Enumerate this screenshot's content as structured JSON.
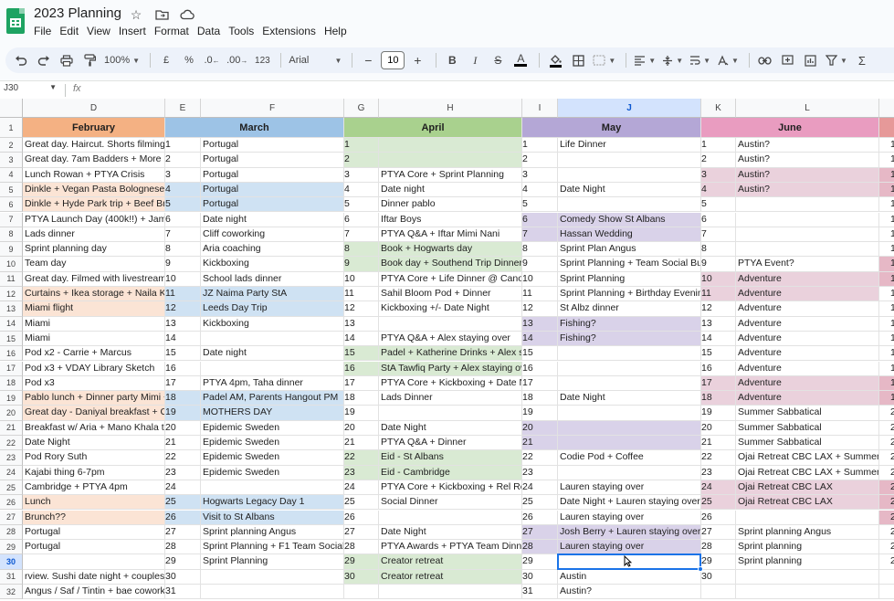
{
  "app": {
    "title": "2023 Planning",
    "icons": [
      "star-icon",
      "move-to-folder-icon",
      "cloud-status-icon"
    ]
  },
  "menu": [
    "File",
    "Edit",
    "View",
    "Insert",
    "Format",
    "Data",
    "Tools",
    "Extensions",
    "Help"
  ],
  "toolbar": {
    "zoom": "100%",
    "currency": "£",
    "percent": "%",
    "dec_decrease": ".0",
    "dec_increase": ".00",
    "number_format": "123",
    "font": "Arial",
    "font_size": "10",
    "minus": "−",
    "plus": "+",
    "bold": "B",
    "italic": "I",
    "strike": "S",
    "text_color": "A",
    "sigma": "Σ"
  },
  "formula_bar": {
    "name_box": "J30",
    "fx": "fx"
  },
  "columns": [
    {
      "letter": "D"
    },
    {
      "letter": "E"
    },
    {
      "letter": "F"
    },
    {
      "letter": "G"
    },
    {
      "letter": "H"
    },
    {
      "letter": "I"
    },
    {
      "letter": "J"
    },
    {
      "letter": "K"
    },
    {
      "letter": "L"
    },
    {
      "letter": ""
    }
  ],
  "active_cell": {
    "col": "J",
    "row": 30
  },
  "months": [
    {
      "name": "February",
      "color": "#f4b183"
    },
    {
      "name": "March",
      "color": "#9dc3e6"
    },
    {
      "name": "April",
      "color": "#a9d18e"
    },
    {
      "name": "May",
      "color": "#b4a7d6"
    },
    {
      "name": "June",
      "color": "#e99cc0"
    }
  ],
  "colors": {
    "feb_shade": "#fbe4d5",
    "mar_shade": "#cfe2f3",
    "apr_shade": "#d9ead3",
    "may_shade": "#d9d2e9",
    "jun_shade": "#ead1dc",
    "accent": "#1a73e8"
  },
  "rows": [
    {
      "n": 1
    },
    {
      "n": 2,
      "feb": "Great day. Haircut. Shorts filming.",
      "mar_d": "1",
      "mar": "Portugal",
      "apr_d": "1",
      "apr": "",
      "may_d": "1",
      "may": "Life Dinner",
      "jun_d": "1",
      "jun": "Austin?",
      "aprS": true
    },
    {
      "n": 3,
      "feb": "Great day. 7am Badders + More P",
      "mar_d": "2",
      "mar": "Portugal",
      "apr_d": "2",
      "apr": "",
      "may_d": "2",
      "may": "",
      "jun_d": "2",
      "jun": "Austin?",
      "aprS": true
    },
    {
      "n": 4,
      "feb": "Lunch Rowan + PTYA Crisis",
      "mar_d": "3",
      "mar": "Portugal",
      "apr_d": "3",
      "apr": "PTYA Core + Sprint Planning",
      "may_d": "3",
      "may": "",
      "jun_d": "3",
      "jun": "Austin?",
      "junS": true
    },
    {
      "n": 5,
      "feb": "Dinkle + Vegan Pasta Bolognese g",
      "mar_d": "4",
      "mar": "Portugal",
      "apr_d": "4",
      "apr": "Date night",
      "may_d": "4",
      "may": "Date Night",
      "jun_d": "4",
      "jun": "Austin?",
      "febS": true,
      "marS": true,
      "junS": true
    },
    {
      "n": 6,
      "feb": "Dinkle + Hyde Park trip + Beef Bro",
      "mar_d": "5",
      "mar": "Portugal",
      "apr_d": "5",
      "apr": "Dinner pablo",
      "may_d": "5",
      "may": "",
      "jun_d": "5",
      "jun": "",
      "febS": true,
      "marS": true
    },
    {
      "n": 7,
      "feb": "PTYA Launch Day (400k!!) + Jame",
      "mar_d": "6",
      "mar": "Date night",
      "apr_d": "6",
      "apr": "Iftar Boys",
      "may_d": "6",
      "may": "Comedy Show St Albans",
      "jun_d": "6",
      "jun": "",
      "mayS": true
    },
    {
      "n": 8,
      "feb": "Lads dinner",
      "mar_d": "7",
      "mar": "Cliff coworking",
      "apr_d": "7",
      "apr": "PTYA Q&A + Iftar Mimi Nani",
      "may_d": "7",
      "may": "Hassan Wedding",
      "jun_d": "7",
      "jun": "",
      "mayS": true
    },
    {
      "n": 9,
      "feb": "Sprint planning day",
      "mar_d": "8",
      "mar": "Aria coaching",
      "apr_d": "8",
      "apr": "Book + Hogwarts day",
      "may_d": "8",
      "may": "Sprint Plan Angus",
      "jun_d": "8",
      "jun": "",
      "aprS": true
    },
    {
      "n": 10,
      "feb": "Team day",
      "mar_d": "9",
      "mar": "Kickboxing",
      "apr_d": "9",
      "apr": "Book day + Southend Trip Dinner",
      "may_d": "9",
      "may": "Sprint Planning + Team Social Bur",
      "jun_d": "9",
      "jun": "PTYA Event?",
      "aprS": true
    },
    {
      "n": 11,
      "feb": "Great day. Filmed with livestream i",
      "mar_d": "10",
      "mar": "School lads dinner",
      "apr_d": "10",
      "apr": "PTYA Core + Life Dinner @ Canor",
      "may_d": "10",
      "may": "Sprint Planning",
      "jun_d": "10",
      "jun": "Adventure",
      "junS": true
    },
    {
      "n": 12,
      "feb": "Curtains + Ikea storage + Naila Kh",
      "mar_d": "11",
      "mar": "JZ Naima Party StA",
      "apr_d": "11",
      "apr": "Sahil Bloom Pod + Dinner",
      "may_d": "11",
      "may": "Sprint Planning + Birthday Evening",
      "jun_d": "11",
      "jun": "Adventure",
      "febS": true,
      "marS": true,
      "junS": true
    },
    {
      "n": 13,
      "feb": "Miami flight",
      "mar_d": "12",
      "mar": "Leeds Day Trip",
      "apr_d": "12",
      "apr": "Kickboxing +/- Date Night",
      "may_d": "12",
      "may": "St Albz dinner",
      "jun_d": "12",
      "jun": "Adventure",
      "febS": true,
      "marS": true
    },
    {
      "n": 14,
      "feb": "Miami",
      "mar_d": "13",
      "mar": "Kickboxing",
      "apr_d": "13",
      "apr": "",
      "may_d": "13",
      "may": "Fishing?",
      "jun_d": "13",
      "jun": "Adventure",
      "mayS": true
    },
    {
      "n": 15,
      "feb": "Miami",
      "mar_d": "14",
      "mar": "",
      "apr_d": "14",
      "apr": "PTYA Q&A + Alex staying over",
      "may_d": "14",
      "may": "Fishing?",
      "jun_d": "14",
      "jun": "Adventure",
      "mayS": true
    },
    {
      "n": 16,
      "feb": "Pod x2 - Carrie + Marcus",
      "mar_d": "15",
      "mar": "Date night",
      "apr_d": "15",
      "apr": "Padel + Katherine Drinks + Alex st",
      "may_d": "15",
      "may": "",
      "jun_d": "15",
      "jun": "Adventure",
      "aprS": true
    },
    {
      "n": 17,
      "feb": "Pod x3 + VDAY Library Sketch",
      "mar_d": "16",
      "mar": "",
      "apr_d": "16",
      "apr": "StA Tawfiq Party + Alex staying ov",
      "may_d": "16",
      "may": "",
      "jun_d": "16",
      "jun": "Adventure",
      "aprS": true
    },
    {
      "n": 18,
      "feb": "Pod x3",
      "mar_d": "17",
      "mar": "PTYA 4pm, Taha dinner",
      "apr_d": "17",
      "apr": "PTYA Core + Kickboxing + Date N",
      "may_d": "17",
      "may": "",
      "jun_d": "17",
      "jun": "Adventure",
      "junS": true
    },
    {
      "n": 19,
      "feb": "Pablo lunch + Dinner party Mimi +",
      "mar_d": "18",
      "mar": "Padel AM, Parents Hangout PM",
      "apr_d": "18",
      "apr": "Lads Dinner",
      "may_d": "18",
      "may": "Date Night",
      "jun_d": "18",
      "jun": "Adventure",
      "febS": true,
      "marS": true,
      "junS": true
    },
    {
      "n": 20,
      "feb": "Great day - Daniyal breakfast + Co",
      "mar_d": "19",
      "mar": "MOTHERS DAY",
      "apr_d": "19",
      "apr": "",
      "may_d": "19",
      "may": "",
      "jun_d": "19",
      "jun": "Summer Sabbatical",
      "febS": true,
      "marS": true
    },
    {
      "n": 21,
      "feb": "Breakfast w/ Aria + Mano Khala tra",
      "mar_d": "20",
      "mar": "Epidemic Sweden",
      "apr_d": "20",
      "apr": "Date Night",
      "may_d": "20",
      "may": "",
      "jun_d": "20",
      "jun": "Summer Sabbatical",
      "mayS": true
    },
    {
      "n": 22,
      "feb": "Date Night",
      "mar_d": "21",
      "mar": "Epidemic Sweden",
      "apr_d": "21",
      "apr": "PTYA Q&A + Dinner",
      "may_d": "21",
      "may": "",
      "jun_d": "21",
      "jun": "Summer Sabbatical",
      "mayS": true
    },
    {
      "n": 23,
      "feb": "Pod Rory Suth",
      "mar_d": "22",
      "mar": "Epidemic Sweden",
      "apr_d": "22",
      "apr": "Eid - St Albans",
      "may_d": "22",
      "may": "Codie Pod + Coffee",
      "jun_d": "22",
      "jun": "Ojai Retreat CBC LAX + Summer",
      "aprS": true
    },
    {
      "n": 24,
      "feb": "Kajabi thing 6-7pm",
      "mar_d": "23",
      "mar": "Epidemic Sweden",
      "apr_d": "23",
      "apr": "Eid - Cambridge",
      "may_d": "23",
      "may": "",
      "jun_d": "23",
      "jun": "Ojai Retreat CBC LAX + Summer",
      "aprS": true
    },
    {
      "n": 25,
      "feb": "Cambridge + PTYA 4pm",
      "mar_d": "24",
      "mar": "",
      "apr_d": "24",
      "apr": "PTYA Core + Kickboxing + Rel Re",
      "may_d": "24",
      "may": "Lauren staying over",
      "jun_d": "24",
      "jun": "Ojai Retreat CBC LAX",
      "junS": true
    },
    {
      "n": 26,
      "feb": "Lunch",
      "mar_d": "25",
      "mar": "Hogwarts Legacy Day 1",
      "apr_d": "25",
      "apr": "Social Dinner",
      "may_d": "25",
      "may": "Date Night + Lauren staying over",
      "jun_d": "25",
      "jun": "Ojai Retreat CBC LAX",
      "febS": true,
      "marS": true,
      "junS": true
    },
    {
      "n": 27,
      "feb": "Brunch??",
      "mar_d": "26",
      "mar": "Visit to St Albans",
      "apr_d": "26",
      "apr": "",
      "may_d": "26",
      "may": "Lauren staying over",
      "jun_d": "26",
      "jun": "",
      "febS": true,
      "marS": true
    },
    {
      "n": 28,
      "feb": "Portugal",
      "mar_d": "27",
      "mar": "Sprint planning Angus",
      "apr_d": "27",
      "apr": "Date Night",
      "may_d": "27",
      "may": "Josh Berry + Lauren staying over",
      "jun_d": "27",
      "jun": "Sprint planning Angus",
      "mayS": true
    },
    {
      "n": 29,
      "feb": "Portugal",
      "mar_d": "28",
      "mar": "Sprint Planning + F1 Team Social",
      "apr_d": "28",
      "apr": "PTYA Awards + PTYA Team Dinne",
      "may_d": "28",
      "may": "Lauren staying over",
      "jun_d": "28",
      "jun": "Sprint planning",
      "mayS": true
    },
    {
      "n": 30,
      "feb": "",
      "mar_d": "29",
      "mar": "Sprint Planning",
      "apr_d": "29",
      "apr": "Creator retreat",
      "may_d": "29",
      "may": "",
      "jun_d": "29",
      "jun": "Sprint planning",
      "aprS": true
    },
    {
      "n": 31,
      "feb": "rview. Sushi date night + couples th",
      "mar_d": "30",
      "mar": "",
      "apr_d": "30",
      "apr": "Creator retreat",
      "may_d": "30",
      "may": "Austin",
      "jun_d": "30",
      "jun": "",
      "aprS": true
    },
    {
      "n": 32,
      "feb": " Angus / Saf / Tintin + bae coworkin",
      "mar_d": "31",
      "mar": "",
      "apr_d": "",
      "apr": "",
      "may_d": "31",
      "may": "Austin?",
      "jun_d": "",
      "jun": ""
    }
  ],
  "right_edge_digits": [
    "1",
    "1",
    "1",
    "1",
    "1",
    "1",
    "1",
    "1",
    "1",
    "1",
    "1",
    "1",
    "1",
    "1",
    "1",
    "1",
    "1",
    "1",
    "2",
    "2",
    "2",
    "2",
    "2",
    "2",
    "2",
    "2",
    "2",
    "2",
    "2"
  ]
}
